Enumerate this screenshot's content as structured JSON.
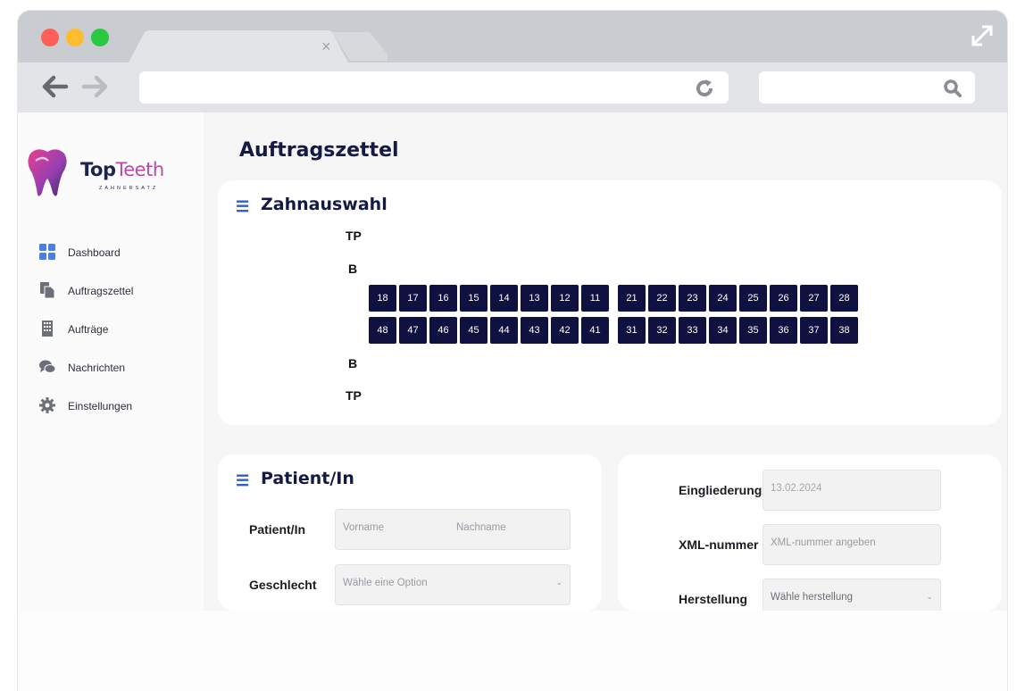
{
  "browser": {
    "tab_close": "×"
  },
  "sidebar": {
    "logo": {
      "name_top": "Top",
      "name_teeth": "Teeth",
      "subtitle": "ZAHNERSATZ"
    },
    "items": [
      {
        "label": "Dashboard",
        "icon": "dashboard-grid-icon"
      },
      {
        "label": "Auftragszettel",
        "icon": "document-copy-icon"
      },
      {
        "label": "Aufträge",
        "icon": "building-icon"
      },
      {
        "label": "Nachrichten",
        "icon": "chat-bubbles-icon"
      },
      {
        "label": "Einstellungen",
        "icon": "gear-icon"
      }
    ]
  },
  "main": {
    "page_title": "Auftragszettel",
    "zahnauswahl": {
      "title": "Zahnauswahl",
      "labels": {
        "tp_top": "TP",
        "b_top": "B",
        "b_bottom": "B",
        "tp_bottom": "TP"
      },
      "upper_right": [
        "18",
        "17",
        "16",
        "15",
        "14",
        "13",
        "12",
        "11"
      ],
      "upper_left": [
        "21",
        "22",
        "23",
        "24",
        "25",
        "26",
        "27",
        "28"
      ],
      "lower_right": [
        "48",
        "47",
        "46",
        "45",
        "44",
        "43",
        "42",
        "41"
      ],
      "lower_left": [
        "31",
        "32",
        "33",
        "34",
        "35",
        "36",
        "37",
        "38"
      ]
    },
    "patient": {
      "title": "Patient/In",
      "name_label": "Patient/In",
      "vorname_placeholder": "Vorname",
      "nachname_placeholder": "Nachname",
      "gender_label": "Geschlecht",
      "gender_placeholder": "Wähle eine Option"
    },
    "order": {
      "eingliederung_label": "Eingliederung",
      "eingliederung_value": "13.02.2024",
      "xml_label": "XML-nummer",
      "xml_placeholder": "XML-nummer angeben",
      "herstellung_label": "Herstellung",
      "herstellung_placeholder": "Wähle herstellung"
    }
  },
  "colors": {
    "tooth_bg": "#0f1240",
    "title": "#141a45",
    "accent": "#2f5fc6",
    "logo_pink": "#b94aa7"
  }
}
